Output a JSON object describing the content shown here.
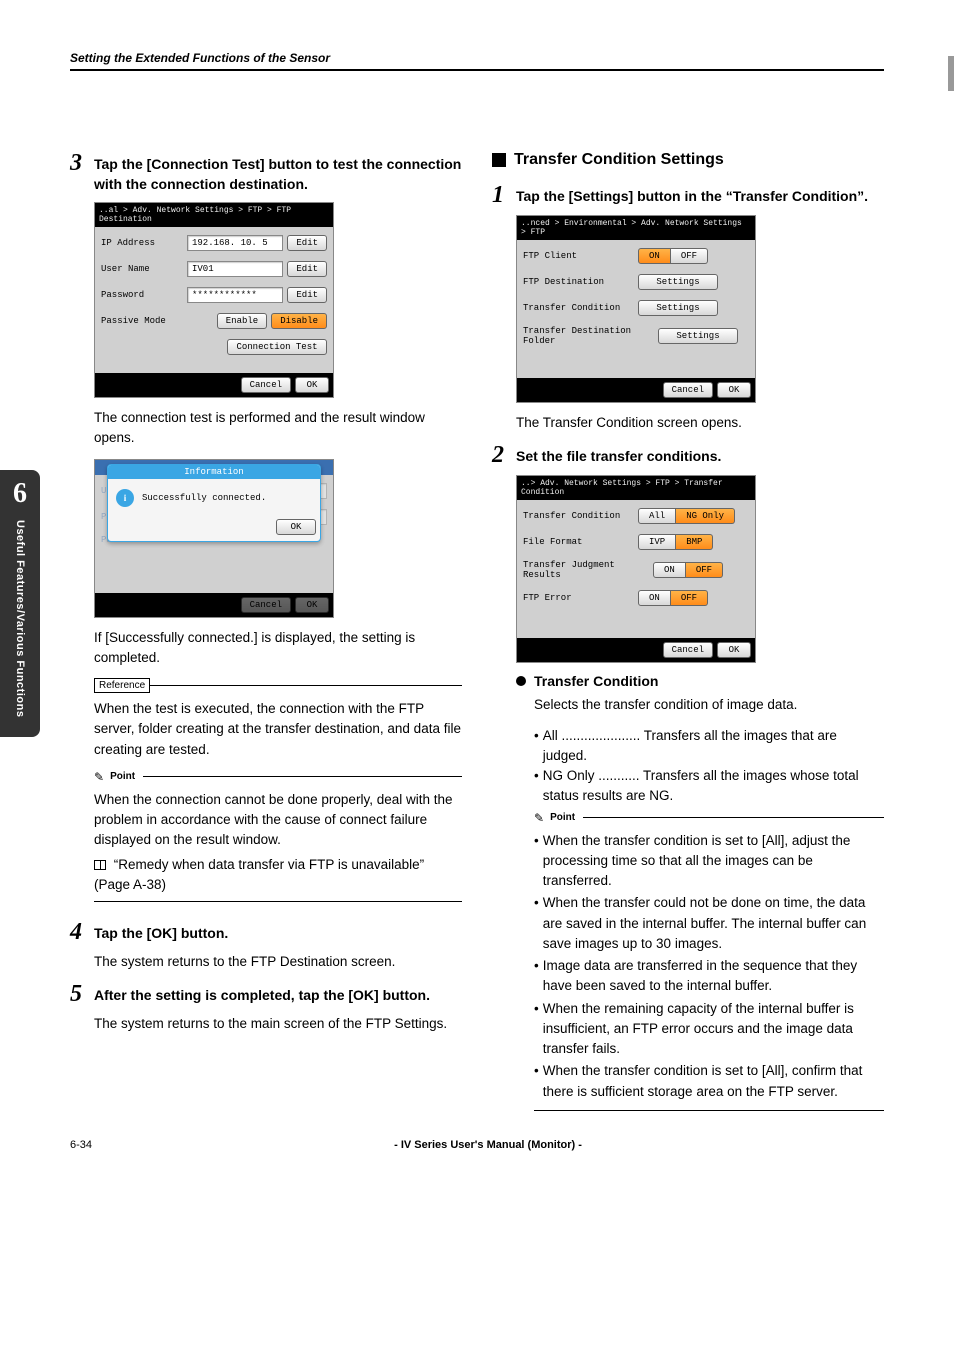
{
  "header": {
    "title": "Setting the Extended Functions of the Sensor"
  },
  "sidebar": {
    "number": "6",
    "label": "Useful Features/Various Functions"
  },
  "left": {
    "step3": {
      "num": "3",
      "title": "Tap the [Connection Test] button to test the connection with the connection destination.",
      "screen": {
        "breadcrumb": "..al > Adv. Network Settings > FTP > FTP Destination",
        "rows": {
          "ip_label": "IP Address",
          "ip_value": "192.168. 10.  5",
          "user_label": "User Name",
          "user_value": "IV01",
          "pass_label": "Password",
          "pass_value": "************",
          "passive_label": "Passive Mode"
        },
        "buttons": {
          "edit": "Edit",
          "enable": "Enable",
          "disable": "Disable",
          "conn_test": "Connection Test",
          "cancel": "Cancel",
          "ok": "OK"
        }
      },
      "after1": "The connection test is performed and the result window opens.",
      "info_dialog": {
        "title": "Information",
        "msg": "Successfully connected.",
        "ok": "OK"
      },
      "after2": "If [Successfully connected.] is displayed, the setting is completed.",
      "reference": {
        "label": "Reference",
        "text": "When the test is executed, the connection with the FTP server, folder creating at the transfer destination, and data file creating are tested."
      },
      "point": {
        "label": "Point",
        "text": "When the connection cannot be done properly, deal with the problem in accordance with the cause of connect failure displayed on the result window.",
        "link": "“Remedy when data transfer via FTP is unavailable” (Page A-38)"
      }
    },
    "step4": {
      "num": "4",
      "title": "Tap the [OK] button.",
      "text": "The system returns to the FTP Destination screen."
    },
    "step5": {
      "num": "5",
      "title": "After the setting is completed, tap the [OK] button.",
      "text": "The system returns to the main screen of the FTP Settings."
    }
  },
  "right": {
    "h2": "Transfer Condition Settings",
    "step1": {
      "num": "1",
      "title": "Tap the [Settings] button in the “Transfer Condition”.",
      "screen": {
        "breadcrumb": "..nced > Environmental > Adv. Network Settings > FTP",
        "rows": {
          "client": "FTP Client",
          "dest": "FTP Destination",
          "cond": "Transfer Condition",
          "folder": "Transfer Destination Folder"
        },
        "buttons": {
          "on": "ON",
          "off": "OFF",
          "settings": "Settings",
          "cancel": "Cancel",
          "ok": "OK"
        }
      },
      "after": "The Transfer Condition screen opens."
    },
    "step2": {
      "num": "2",
      "title": "Set the file transfer conditions.",
      "screen": {
        "breadcrumb": "..> Adv. Network Settings > FTP > Transfer Condition",
        "rows": {
          "cond": "Transfer Condition",
          "format": "File Format",
          "judge": "Transfer Judgment Results",
          "err": "FTP Error"
        },
        "opts": {
          "all": "All",
          "ng": "NG Only",
          "ivp": "IVP",
          "bmp": "BMP",
          "on": "ON",
          "off": "OFF",
          "cancel": "Cancel",
          "ok": "OK"
        }
      }
    },
    "cond_section": {
      "title": "Transfer Condition",
      "intro": "Selects the transfer condition of image data.",
      "items": {
        "all_key": "All",
        "all_dots": ".....................",
        "all_val": "Transfers all the images that are judged.",
        "ng_key": "NG Only",
        "ng_dots": "...........",
        "ng_val": "Transfers all the images whose total status results are NG."
      },
      "point": {
        "label": "Point",
        "bullets": [
          "When the transfer condition is set to [All], adjust the processing time so that all the images can be transferred.",
          "When the transfer could not be done on time, the data are saved in the internal buffer. The internal buffer can save images up to 30 images.",
          "Image data are transferred in the sequence that they have been saved to the internal buffer.",
          "When the remaining capacity of the internal buffer is insufficient, an FTP error occurs and the image data transfer fails.",
          "When the transfer condition is set to [All], confirm that there is sufficient storage area on the FTP server."
        ]
      }
    }
  },
  "footer": {
    "page": "6-34",
    "center": "- IV Series User's Manual (Monitor) -"
  }
}
